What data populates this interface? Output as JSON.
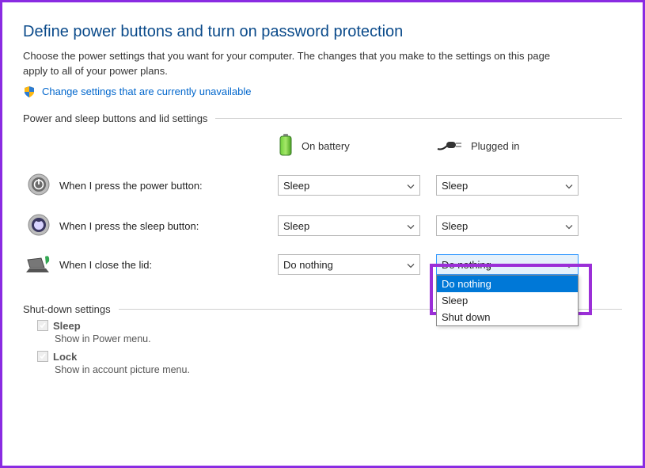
{
  "title": "Define power buttons and turn on password protection",
  "intro": "Choose the power settings that you want for your computer. The changes that you make to the settings on this page apply to all of your power plans.",
  "link": "Change settings that are currently unavailable",
  "section1": "Power and sleep buttons and lid settings",
  "columns": {
    "battery": "On battery",
    "plugged": "Plugged in"
  },
  "rows": {
    "power": {
      "label": "When I press the power button:",
      "battery": "Sleep",
      "plugged": "Sleep"
    },
    "sleep": {
      "label": "When I press the sleep button:",
      "battery": "Sleep",
      "plugged": "Sleep"
    },
    "lid": {
      "label": "When I close the lid:",
      "battery": "Do nothing",
      "plugged": "Do nothing"
    }
  },
  "dropdown_options": [
    "Do nothing",
    "Sleep",
    "Shut down"
  ],
  "section2": "Shut-down settings",
  "shutdown": {
    "sleep": {
      "label": "Sleep",
      "desc": "Show in Power menu."
    },
    "lock": {
      "label": "Lock",
      "desc": "Show in account picture menu."
    }
  }
}
